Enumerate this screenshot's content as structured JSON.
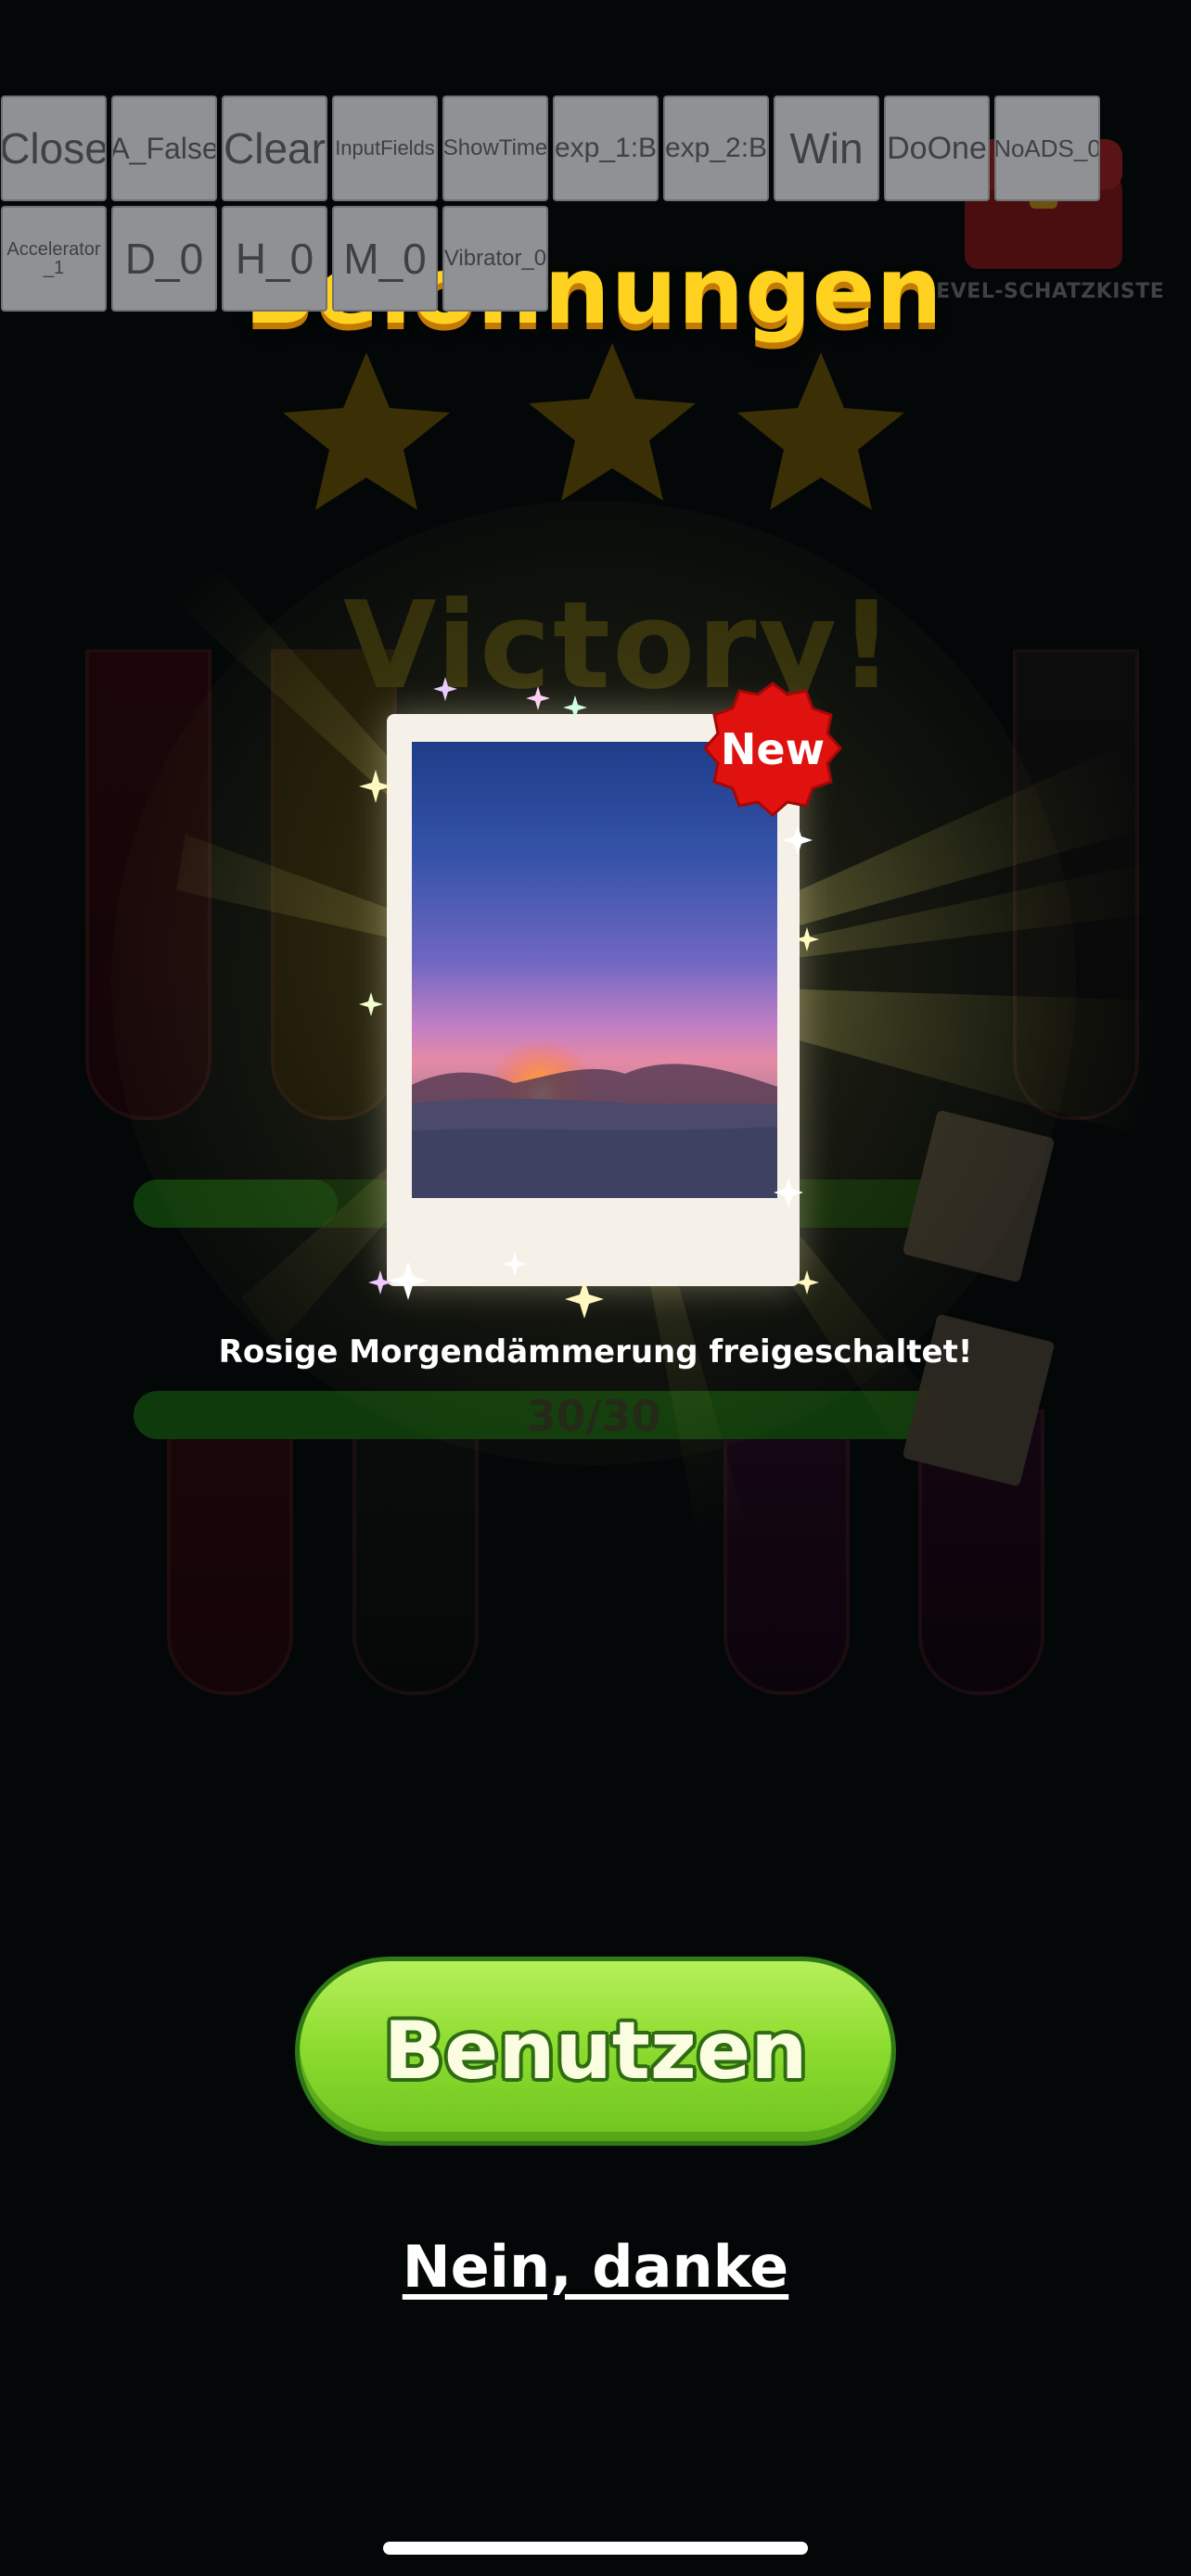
{
  "debug_toolbar": {
    "buttons": [
      {
        "label": "Close"
      },
      {
        "label": "A_False"
      },
      {
        "label": "Clear"
      },
      {
        "label": "InputFields"
      },
      {
        "label": "ShowTime"
      },
      {
        "label": "exp_1:B"
      },
      {
        "label": "exp_2:B"
      },
      {
        "label": "Win"
      },
      {
        "label": "DoOne"
      },
      {
        "label": "NoADS_0"
      },
      {
        "label": "Accelerator_1"
      },
      {
        "label": "D_0"
      },
      {
        "label": "H_0"
      },
      {
        "label": "M_0"
      },
      {
        "label": "Vibrator_0"
      }
    ]
  },
  "background": {
    "chest_label": "LEVEL-SCHATZKISTE",
    "victory_text": "Victory!",
    "progress_text": "30/30"
  },
  "reward": {
    "title": "Belohnungen",
    "badge": "New",
    "unlock_message": "Rosige Morgendämmerung freigeschaltet!"
  },
  "actions": {
    "use_label": "Benutzen",
    "decline_label": "Nein, danke"
  },
  "colors": {
    "title": "#ffd21f",
    "use_button": "#8fdd31",
    "badge": "#e0120f"
  }
}
